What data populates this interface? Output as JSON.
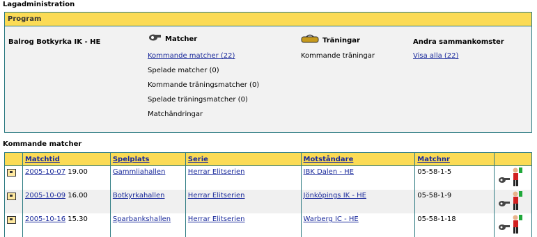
{
  "page": {
    "title": "Lagadministration"
  },
  "program": {
    "header": "Program",
    "team": "Balrog Botkyrka IK - HE",
    "matcher": {
      "title": "Matcher",
      "items": [
        {
          "label": "Kommande matcher (22)",
          "link": true
        },
        {
          "label": "Spelade matcher (0)",
          "link": false
        },
        {
          "label": "Kommande träningsmatcher (0)",
          "link": false
        },
        {
          "label": "Spelade träningsmatcher (0)",
          "link": false
        },
        {
          "label": "Matchändringar",
          "link": false
        }
      ]
    },
    "traningar": {
      "title": "Träningar",
      "items": [
        {
          "label": "Kommande träningar",
          "link": false
        }
      ]
    },
    "andra": {
      "title": "Andra sammankomster",
      "items": [
        {
          "label": "Visa alla (22)",
          "link": true
        }
      ]
    }
  },
  "matches": {
    "title": "Kommande matcher",
    "columns": [
      "Matchtid",
      "Spelplats",
      "Serie",
      "Motståndare",
      "Matchnr"
    ],
    "rows": [
      {
        "date": "2005-10-07",
        "time": "19.00",
        "venue": "Gammliahallen",
        "series": "Herrar Elitserien",
        "opponent": "IBK Dalen - HE",
        "matchnr": "05-58-1-5"
      },
      {
        "date": "2005-10-09",
        "time": "16.00",
        "venue": "Botkyrkahallen",
        "series": "Herrar Elitserien",
        "opponent": "Jönköpings IK - HE",
        "matchnr": "05-58-1-9"
      },
      {
        "date": "2005-10-16",
        "time": "15.30",
        "venue": "Sparbankshallen",
        "series": "Herrar Elitserien",
        "opponent": "Warberg IC - HE",
        "matchnr": "05-58-1-18"
      }
    ]
  },
  "icons": {
    "whistle": "whistle-icon",
    "training": "training-bag-icon",
    "row": "match-detail-icon",
    "referee": "referee-icon"
  }
}
